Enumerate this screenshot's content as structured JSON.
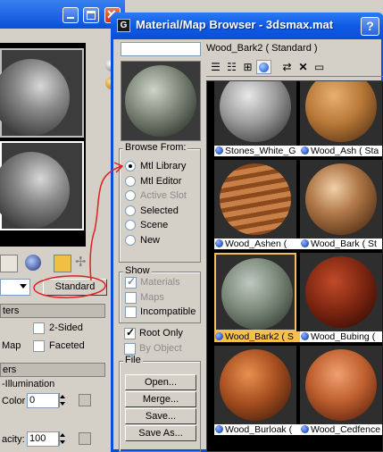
{
  "material_editor": {
    "type_button_label": "Standard",
    "rollouts": {
      "shader_basic": "ters",
      "blinn_basic": "ers"
    },
    "two_sided_label": "2-Sided",
    "map_label": "Map",
    "faceted_label": "Faceted",
    "self_illumination_label": "-Illumination",
    "color_label": "Color",
    "color_value": "0",
    "opacity_label": "acity:",
    "opacity_value": "100"
  },
  "browser": {
    "title": "Material/Map Browser - 3dsmax.mat",
    "app_icon": "G",
    "help_label": "?",
    "current_material": "Wood_Bark2  ( Standard )",
    "browse_from": {
      "title": "Browse From:",
      "options": [
        {
          "label": "Mtl Library",
          "selected": true,
          "enabled": true
        },
        {
          "label": "Mtl Editor",
          "selected": false,
          "enabled": true
        },
        {
          "label": "Active Slot",
          "selected": false,
          "enabled": false
        },
        {
          "label": "Selected",
          "selected": false,
          "enabled": true
        },
        {
          "label": "Scene",
          "selected": false,
          "enabled": true
        },
        {
          "label": "New",
          "selected": false,
          "enabled": true
        }
      ]
    },
    "show": {
      "title": "Show",
      "options": [
        {
          "label": "Materials",
          "checked": true,
          "enabled": false
        },
        {
          "label": "Maps",
          "checked": false,
          "enabled": false
        },
        {
          "label": "Incompatible",
          "checked": false,
          "enabled": true
        }
      ]
    },
    "view": {
      "options": [
        {
          "label": "Root Only",
          "checked": true,
          "enabled": true
        },
        {
          "label": "By Object",
          "checked": false,
          "enabled": false
        }
      ]
    },
    "file": {
      "title": "File",
      "buttons": [
        "Open...",
        "Merge...",
        "Save...",
        "Save As..."
      ]
    },
    "materials": [
      {
        "label": "Stones_White_G",
        "texture": "stones"
      },
      {
        "label": "Wood_Ash  ( Sta",
        "texture": "ash"
      },
      {
        "label": "Wood_Ashen  ( ",
        "texture": "ashen"
      },
      {
        "label": "Wood_Bark  ( St",
        "texture": "bark"
      },
      {
        "label": "Wood_Bark2  ( S",
        "texture": "bark2",
        "selected": true
      },
      {
        "label": "Wood_Bubing  (",
        "texture": "bubing"
      },
      {
        "label": "Wood_Burloak  (",
        "texture": "burloak"
      },
      {
        "label": "Wood_Cedfence",
        "texture": "cedfence"
      }
    ]
  },
  "colors": {
    "title_bar": "#0a50d8",
    "selection": "#f4c24a",
    "annotation": "#e02020"
  }
}
